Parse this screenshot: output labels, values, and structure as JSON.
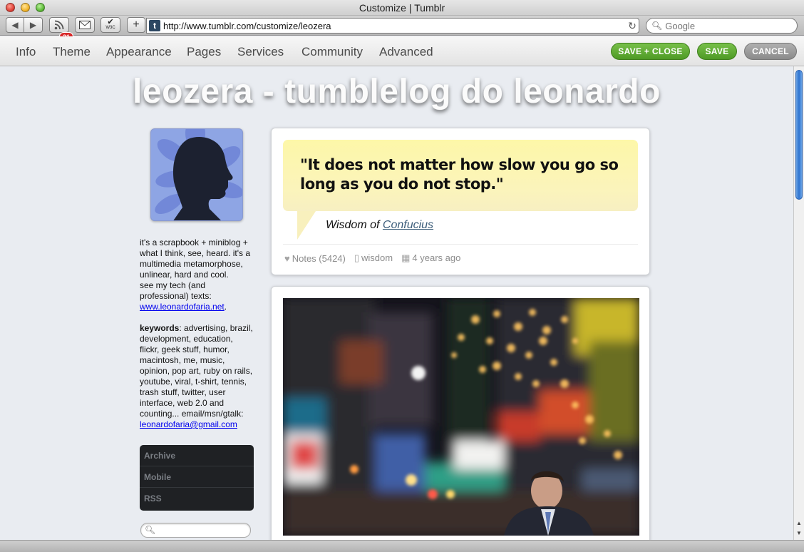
{
  "window": {
    "title": "Customize | Tumblr"
  },
  "browser": {
    "rss_badge": "21",
    "w3c_label": "W3C",
    "url": "http://www.tumblr.com/customize/leozera",
    "search_placeholder": "Google"
  },
  "customize": {
    "nav": [
      "Info",
      "Theme",
      "Appearance",
      "Pages",
      "Services",
      "Community",
      "Advanced"
    ],
    "save_close_label": "SAVE + CLOSE",
    "save_label": "SAVE",
    "cancel_label": "CANCEL",
    "colors": {
      "green": "#5aa82e",
      "gray": "#999999"
    }
  },
  "blog": {
    "title": "leozera - tumblelog do leonardo",
    "description_lines": [
      "it's a scrapbook + miniblog +",
      "what I think, see, heard. it's a",
      "multimedia metamorphose,",
      "unlinear, hard and cool.",
      "see my tech (and",
      "professional) texts:"
    ],
    "website_link": "www.leonardofaria.net",
    "website_suffix": ".",
    "keywords_label": "keywords",
    "keywords_lines": [
      ": advertising, brazil,",
      "development, education,",
      "flickr, geek stuff, humor,",
      "macintosh, me, music,",
      "opinion, pop art, ruby on rails,",
      "youtube, viral, t-shirt, tennis,",
      "trash stuff, twitter, user",
      "interface, web 2.0 and",
      "counting... email/msn/gtalk:"
    ],
    "email_link": "leonardofaria@gmail.com",
    "menu": [
      "Archive",
      "Mobile",
      "RSS"
    ]
  },
  "posts": {
    "quote": {
      "text": "\"It does not matter how slow you go so long as you do not stop.\"",
      "source_prefix": "Wisdom of",
      "source_link": "Confucius",
      "notes": "Notes (5424)",
      "tag": "wisdom",
      "date": "4 years ago"
    }
  }
}
